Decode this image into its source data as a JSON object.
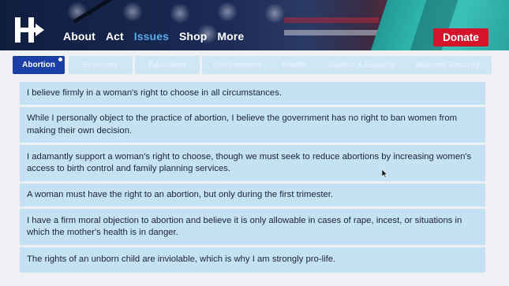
{
  "header": {
    "nav": [
      {
        "label": "About",
        "active": false
      },
      {
        "label": "Act",
        "active": false
      },
      {
        "label": "Issues",
        "active": true
      },
      {
        "label": "Shop",
        "active": false
      },
      {
        "label": "More",
        "active": false
      }
    ],
    "donate_label": "Donate"
  },
  "tabs": [
    {
      "label": "Abortion",
      "active": true
    },
    {
      "label": "Economy",
      "active": false
    },
    {
      "label": "Education",
      "active": false
    },
    {
      "label": "Environment",
      "active": false
    },
    {
      "label": "Health",
      "active": false
    },
    {
      "label": "Justice & Equality",
      "active": false
    },
    {
      "label": "National Security",
      "active": false
    }
  ],
  "options": [
    "I believe firmly in a woman's right to choose in all circumstances.",
    "While I personally object to the practice of abortion, I believe the government has no right to ban women from making their own decision.",
    "I adamantly support a woman's right to choose, though we must seek to reduce abortions by increasing women's access to birth control and family planning services.",
    "A woman must have the right to an abortion, but only during the first trimester.",
    "I have a firm moral objection to abortion and believe it is only allowable in cases of rape, incest, or situations in which the mother's health is in danger.",
    "The rights of an unborn child are inviolable, which is why I am strongly pro-life."
  ],
  "colors": {
    "header_bg": "#15264c",
    "active_nav": "#5aa8e8",
    "donate_bg": "#d3142a",
    "active_tab_bg": "#1a3fa6",
    "inactive_tab_bg": "#cfe7f5",
    "option_bg": "#c4e2f3",
    "page_bg": "#eef0f3"
  },
  "icons": {
    "logo": "hillary-h-arrow-logo",
    "cursor": "mouse-pointer-icon"
  }
}
